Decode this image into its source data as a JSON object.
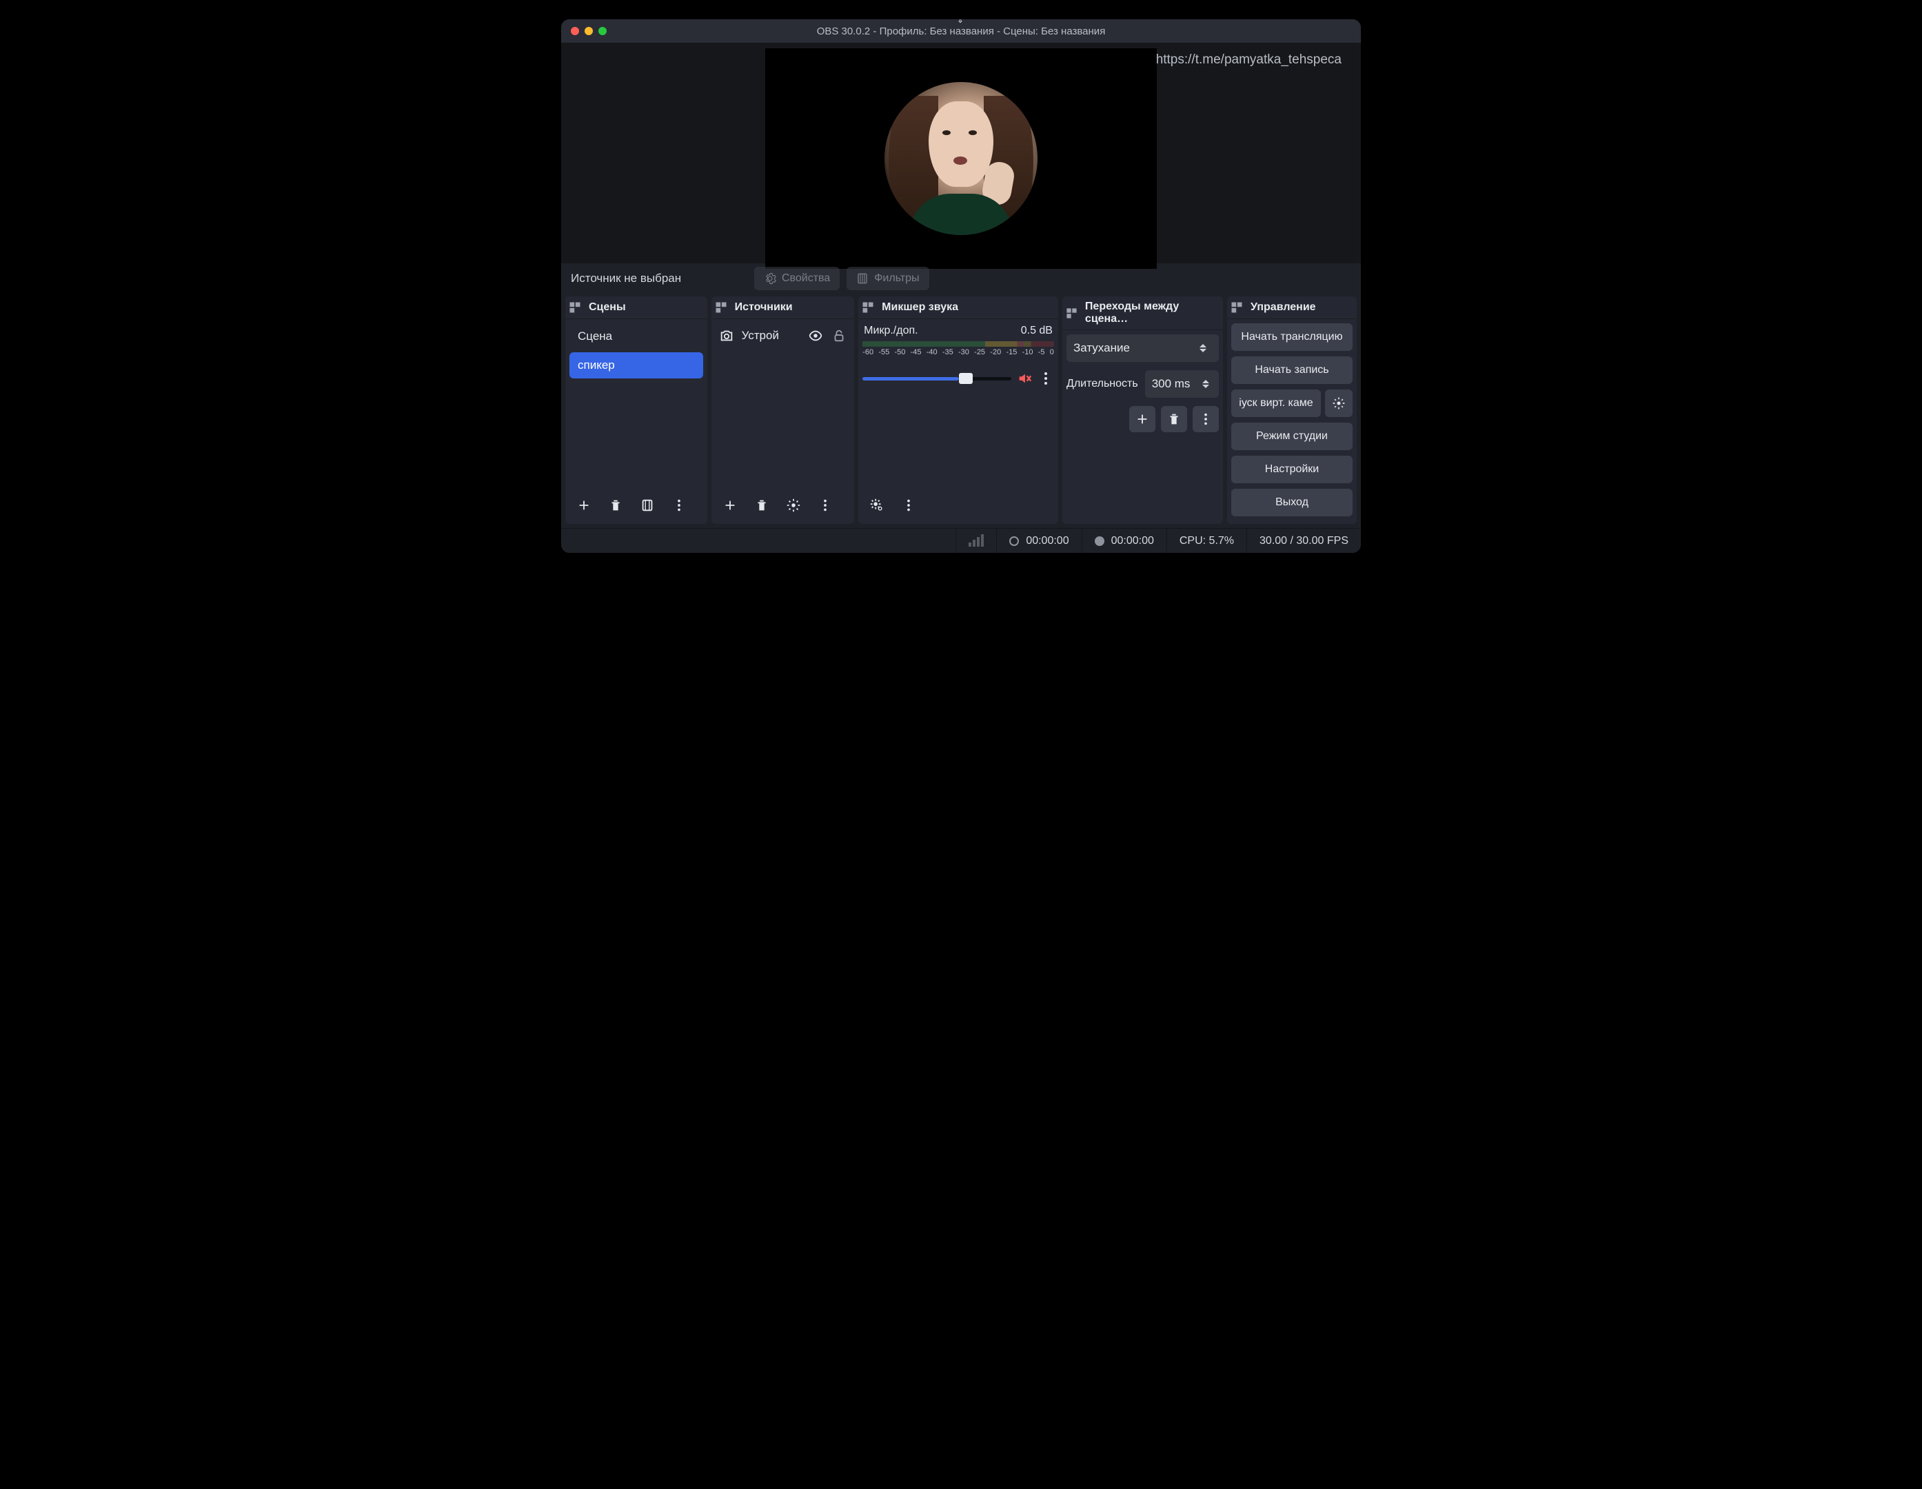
{
  "title": "OBS 30.0.2 - Профиль: Без названия - Сцены: Без названия",
  "watermark": "https://t.me/pamyatka_tehspeca",
  "srcbar": {
    "none": "Источник не выбран",
    "properties": "Свойства",
    "filters": "Фильтры"
  },
  "scenes": {
    "title": "Сцены",
    "items": [
      "Сцена",
      "спикер"
    ],
    "active_index": 1
  },
  "sources": {
    "title": "Источники",
    "items": [
      {
        "name": "Устрой"
      }
    ]
  },
  "mixer": {
    "title": "Микшер звука",
    "channel": "Микр./доп.",
    "level": "0.5 dB",
    "ticks": [
      "-60",
      "-55",
      "-50",
      "-45",
      "-40",
      "-35",
      "-30",
      "-25",
      "-20",
      "-15",
      "-10",
      "-5",
      "0"
    ]
  },
  "transitions": {
    "title": "Переходы между сцена…",
    "current": "Затухание",
    "duration_label": "Длительность",
    "duration_value": "300 ms"
  },
  "controls": {
    "title": "Управление",
    "broadcast": "Начать трансляцию",
    "record": "Начать запись",
    "vcam": "іуск вирт. каме",
    "studio": "Режим студии",
    "settings": "Настройки",
    "exit": "Выход"
  },
  "status": {
    "live_time": "00:00:00",
    "rec_time": "00:00:00",
    "cpu": "CPU: 5.7%",
    "fps": "30.00 / 30.00 FPS"
  }
}
